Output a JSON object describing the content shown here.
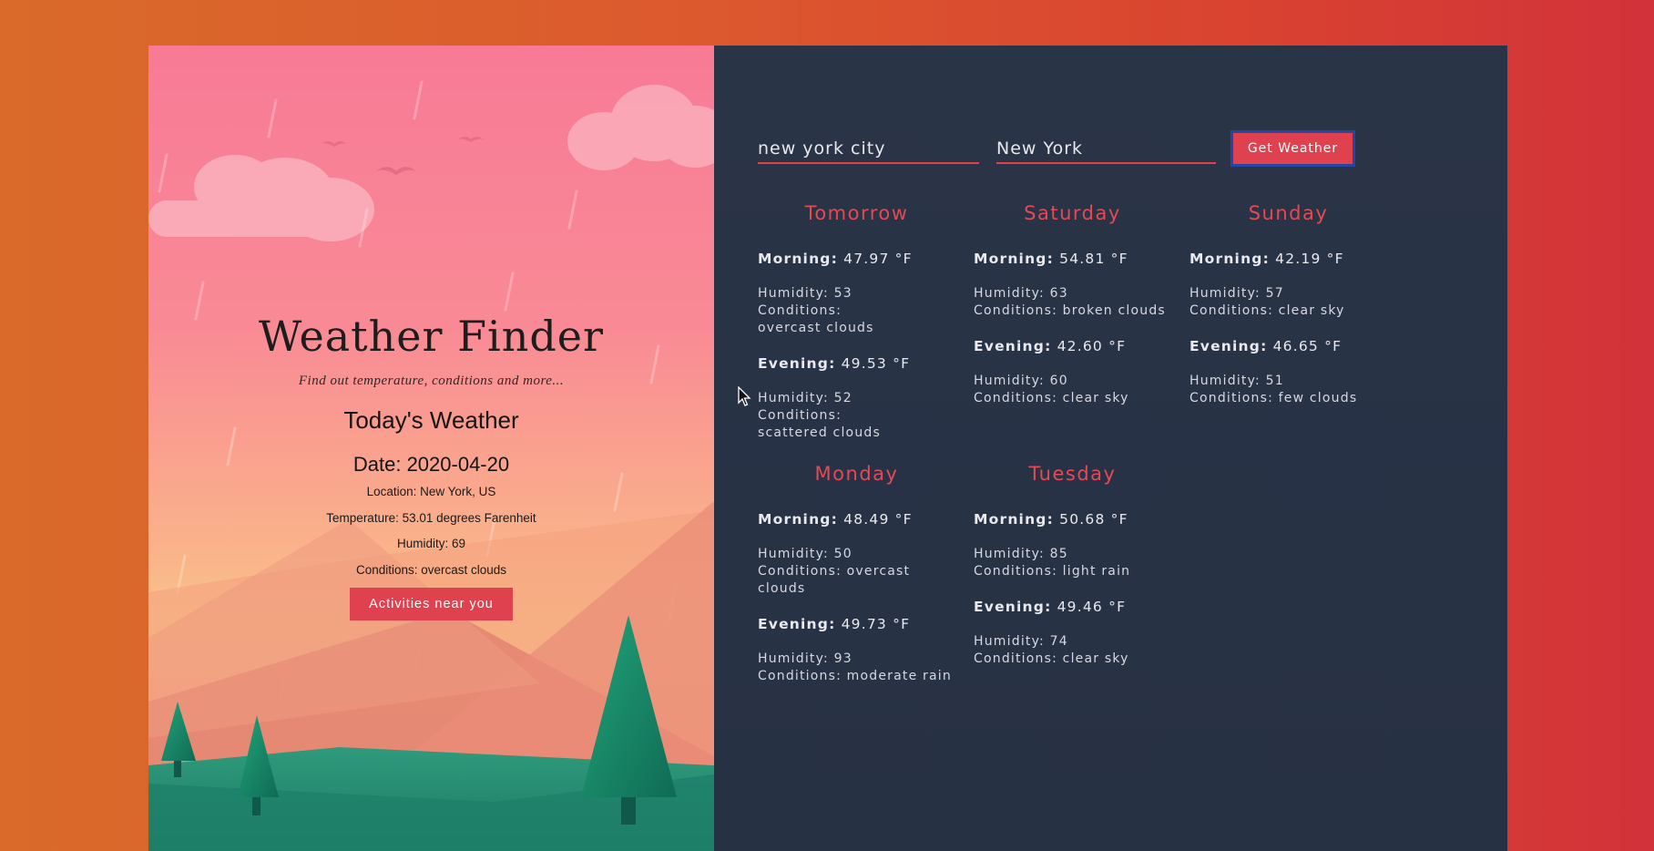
{
  "app": {
    "title": "Weather Finder",
    "subtitle": "Find out temperature, conditions and more..."
  },
  "today": {
    "heading": "Today's Weather",
    "date": "Date: 2020-04-20",
    "location": "Location: New York, US",
    "temperature": "Temperature: 53.01 degrees Farenheit",
    "humidity": "Humidity: 69",
    "conditions": "Conditions: overcast clouds",
    "activities_label": "Activities near you"
  },
  "search": {
    "city_value": "new york city",
    "state_value": "New York",
    "button_label": "Get Weather"
  },
  "forecast": [
    {
      "day": "Tomorrow",
      "morning_label": "Morning:",
      "morning_temp": "47.97 °F",
      "morning_lines": [
        "Humidity: 53",
        "Conditions:",
        "overcast clouds"
      ],
      "evening_label": "Evening:",
      "evening_temp": "49.53 °F",
      "evening_lines": [
        "Humidity: 52",
        "Conditions:",
        "scattered clouds"
      ]
    },
    {
      "day": "Saturday",
      "morning_label": "Morning:",
      "morning_temp": "54.81 °F",
      "morning_lines": [
        "Humidity: 63",
        "Conditions: broken clouds"
      ],
      "evening_label": "Evening:",
      "evening_temp": "42.60 °F",
      "evening_lines": [
        "Humidity: 60",
        "Conditions: clear sky"
      ]
    },
    {
      "day": "Sunday",
      "morning_label": "Morning:",
      "morning_temp": "42.19 °F",
      "morning_lines": [
        "Humidity: 57",
        "Conditions: clear sky"
      ],
      "evening_label": "Evening:",
      "evening_temp": "46.65 °F",
      "evening_lines": [
        "Humidity: 51",
        "Conditions: few clouds"
      ]
    },
    {
      "day": "Monday",
      "morning_label": "Morning:",
      "morning_temp": "48.49 °F",
      "morning_lines": [
        "Humidity: 50",
        "Conditions: overcast",
        "clouds"
      ],
      "evening_label": "Evening:",
      "evening_temp": "49.73 °F",
      "evening_lines": [
        "Humidity: 93",
        "Conditions: moderate rain"
      ]
    },
    {
      "day": "Tuesday",
      "morning_label": "Morning:",
      "morning_temp": "50.68 °F",
      "morning_lines": [
        "Humidity: 85",
        "Conditions: light rain"
      ],
      "evening_label": "Evening:",
      "evening_temp": "49.46 °F",
      "evening_lines": [
        "Humidity: 74",
        "Conditions: clear sky"
      ]
    }
  ],
  "colors": {
    "accent": "#e0414e",
    "panel": "#2a3447",
    "backdrop": "#d9552e"
  }
}
